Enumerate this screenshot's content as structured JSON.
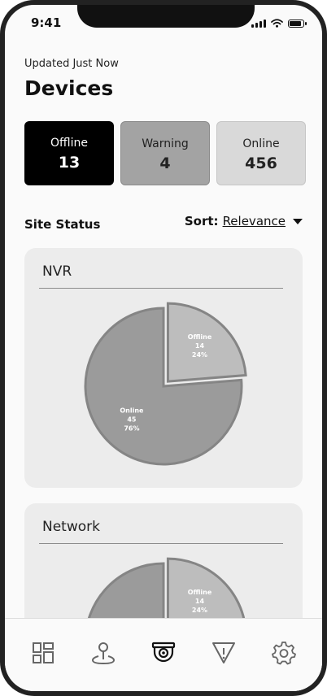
{
  "status_bar": {
    "time": "9:41"
  },
  "header": {
    "updated": "Updated Just Now",
    "title": "Devices"
  },
  "summary": [
    {
      "label": "Offline",
      "value": "13"
    },
    {
      "label": "Warning",
      "value": "4"
    },
    {
      "label": "Online",
      "value": "456"
    }
  ],
  "section": {
    "title": "Site Status",
    "sort_label": "Sort:",
    "sort_value": "Relevance"
  },
  "cards": [
    {
      "title": "NVR",
      "chart_data": {
        "type": "pie",
        "slices": [
          {
            "label": "Offline",
            "value": 14,
            "percent": "24%"
          },
          {
            "label": "Online",
            "value": 45,
            "percent": "76%"
          }
        ]
      }
    },
    {
      "title": "Network",
      "chart_data": {
        "type": "pie",
        "slices": [
          {
            "label": "Offline",
            "value": 14,
            "percent": "24%"
          },
          {
            "label": "Online",
            "value": 45,
            "percent": "76%"
          }
        ]
      }
    }
  ],
  "colors": {
    "offline_slice": "#bdbdbd",
    "online_slice": "#9b9b9b",
    "slice_stroke": "#858585"
  },
  "tabs": [
    {
      "icon": "dashboard-icon"
    },
    {
      "icon": "map-pin-icon"
    },
    {
      "icon": "camera-icon",
      "active": true
    },
    {
      "icon": "alert-icon"
    },
    {
      "icon": "settings-icon"
    }
  ]
}
